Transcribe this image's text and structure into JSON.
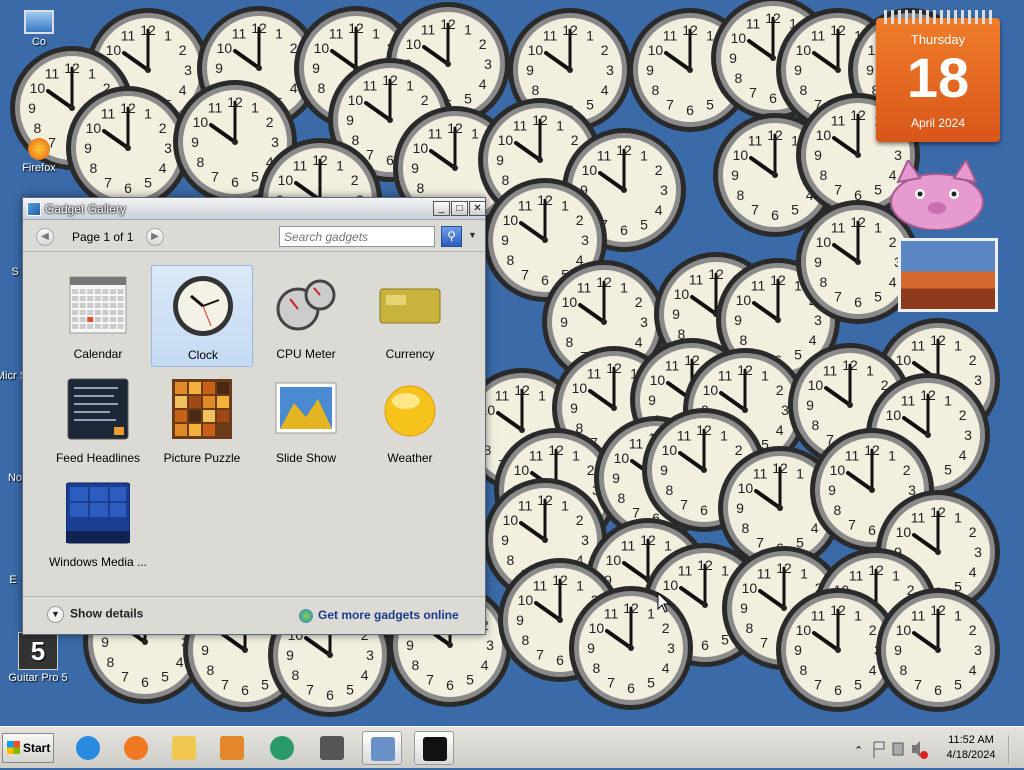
{
  "desktop_icons": [
    {
      "id": "computer",
      "label": "Co"
    },
    {
      "id": "firefox",
      "label": "Firefox"
    },
    {
      "id": "s-app",
      "label": "S"
    },
    {
      "id": "micro",
      "label": "Micr St"
    },
    {
      "id": "no",
      "label": "No"
    },
    {
      "id": "e",
      "label": "E"
    },
    {
      "id": "guitar-pro",
      "label": "Guitar Pro 5"
    }
  ],
  "calendar_gadget": {
    "weekday": "Thursday",
    "day": "18",
    "month_year": "April 2024"
  },
  "gallery": {
    "title": "Gadget Gallery",
    "page_text": "Page 1 of 1",
    "search_placeholder": "Search gadgets",
    "items": [
      {
        "label": "Calendar",
        "icon": "calendar-icon",
        "selected": false
      },
      {
        "label": "Clock",
        "icon": "clock-icon",
        "selected": true
      },
      {
        "label": "CPU Meter",
        "icon": "cpu-meter-icon",
        "selected": false
      },
      {
        "label": "Currency",
        "icon": "currency-icon",
        "selected": false
      },
      {
        "label": "Feed Headlines",
        "icon": "feed-icon",
        "selected": false
      },
      {
        "label": "Picture Puzzle",
        "icon": "puzzle-icon",
        "selected": false
      },
      {
        "label": "Slide Show",
        "icon": "slideshow-icon",
        "selected": false
      },
      {
        "label": "Weather",
        "icon": "weather-icon",
        "selected": false
      },
      {
        "label": "Windows Media ...",
        "icon": "media-center-icon",
        "selected": false
      }
    ],
    "show_details": "Show details",
    "get_more": "Get more gadgets online"
  },
  "taskbar": {
    "start_label": "Start",
    "buttons": [
      {
        "name": "internet-explorer-icon"
      },
      {
        "name": "firefox-icon"
      },
      {
        "name": "folder-icon"
      },
      {
        "name": "media-player-icon"
      },
      {
        "name": "messenger-icon"
      },
      {
        "name": "guitar-pro-icon"
      },
      {
        "name": "gadget-gallery-icon",
        "active": true
      },
      {
        "name": "command-prompt-icon",
        "active": true
      }
    ],
    "time": "11:52 AM",
    "date": "4/18/2024"
  },
  "colors": {
    "desktop": "#3a6aa8",
    "calendar": "#e8692a",
    "accent": "#1a3a8c"
  }
}
